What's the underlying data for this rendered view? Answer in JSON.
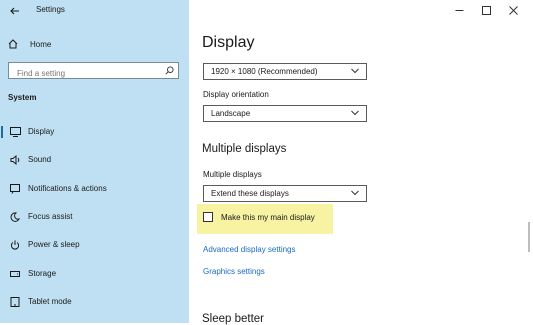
{
  "window": {
    "title": "Settings",
    "controls": [
      "minimize",
      "maximize",
      "close"
    ]
  },
  "sidebar": {
    "home_label": "Home",
    "search_placeholder": "Find a setting",
    "section_header": "System",
    "items": [
      {
        "label": "Display",
        "icon": "monitor-icon",
        "active": true
      },
      {
        "label": "Sound",
        "icon": "speaker-icon",
        "active": false
      },
      {
        "label": "Notifications & actions",
        "icon": "notification-icon",
        "active": false
      },
      {
        "label": "Focus assist",
        "icon": "moon-icon",
        "active": false
      },
      {
        "label": "Power & sleep",
        "icon": "power-icon",
        "active": false
      },
      {
        "label": "Storage",
        "icon": "storage-icon",
        "active": false
      },
      {
        "label": "Tablet mode",
        "icon": "tablet-icon",
        "active": false
      }
    ]
  },
  "main": {
    "page_title": "Display",
    "resolution_value": "1920 × 1080 (Recommended)",
    "orientation_label": "Display orientation",
    "orientation_value": "Landscape",
    "multiple_displays_heading": "Multiple displays",
    "multiple_displays_label": "Multiple displays",
    "multiple_displays_value": "Extend these displays",
    "main_display_checkbox_label": "Make this my main display",
    "main_display_checked": false,
    "advanced_link": "Advanced display settings",
    "graphics_link": "Graphics settings",
    "next_heading": "Sleep better"
  },
  "colors": {
    "sidebar_bg": "#bfe0f2",
    "accent": "#1a6ea3",
    "link": "#1a6bc0",
    "highlight": "#f7f3a2"
  }
}
